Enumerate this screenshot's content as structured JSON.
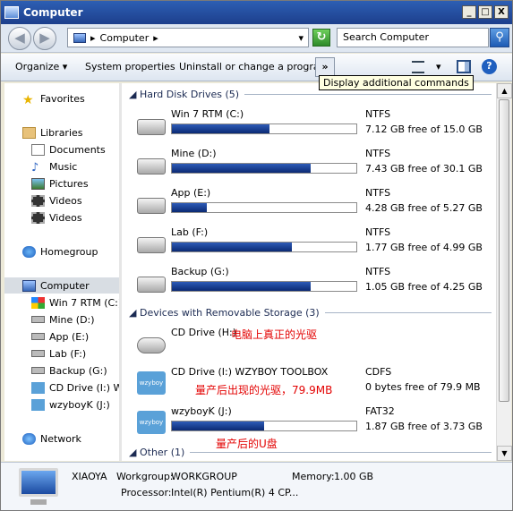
{
  "window": {
    "title": "Computer",
    "controls": [
      "_",
      "□",
      "X"
    ]
  },
  "address": {
    "back": "back",
    "forward": "forward",
    "path": "Computer",
    "search_placeholder": "Search Computer"
  },
  "toolbar": {
    "organize": "Organize",
    "system_properties": "System properties",
    "uninstall": "Uninstall or change a program",
    "more": "»",
    "tooltip": "Display additional commands"
  },
  "sidebar": {
    "favorites": "Favorites",
    "libraries": "Libraries",
    "lib_items": [
      "Documents",
      "Music",
      "Pictures",
      "Videos",
      "Videos"
    ],
    "homegroup": "Homegroup",
    "computer": "Computer",
    "computer_items": [
      "Win 7 RTM (C:)",
      "Mine (D:)",
      "App (E:)",
      "Lab (F:)",
      "Backup (G:)",
      "CD Drive (I:) WZ",
      "wzyboyK (J:)"
    ],
    "network": "Network"
  },
  "groups": {
    "hdd": "Hard Disk Drives (5)",
    "removable": "Devices with Removable Storage (3)",
    "other": "Other (1)"
  },
  "drives": [
    {
      "name": "Win 7 RTM (C:)",
      "fs": "NTFS",
      "free_text": "7.12 GB free of 15.0 GB",
      "used_fraction": 0.53
    },
    {
      "name": "Mine (D:)",
      "fs": "NTFS",
      "free_text": "7.43 GB free of 30.1 GB",
      "used_fraction": 0.75
    },
    {
      "name": "App (E:)",
      "fs": "NTFS",
      "free_text": "4.28 GB free of 5.27 GB",
      "used_fraction": 0.19
    },
    {
      "name": "Lab (F:)",
      "fs": "NTFS",
      "free_text": "1.77 GB free of 4.99 GB",
      "used_fraction": 0.65
    },
    {
      "name": "Backup (G:)",
      "fs": "NTFS",
      "free_text": "1.05 GB free of 4.25 GB",
      "used_fraction": 0.75
    }
  ],
  "removable": [
    {
      "name": "CD Drive (H:)",
      "annotation": "电脑上真正的光驱"
    },
    {
      "name": "CD Drive (I:) WZYBOY TOOLBOX",
      "fs": "CDFS",
      "free_text": "0 bytes free of 79.9 MB",
      "annotation": "量产后出现的光驱，79.9MB",
      "logo_text": "wzyboy"
    },
    {
      "name": "wzyboyK (J:)",
      "fs": "FAT32",
      "free_text": "1.87 GB free of 3.73 GB",
      "used_fraction": 0.5,
      "annotation": "量产后的U盘",
      "logo_text": "wzyboy"
    }
  ],
  "status": {
    "pc_name": "XIAOYA",
    "workgroup_label": "Workgroup:",
    "workgroup": "WORKGROUP",
    "memory_label": "Memory:",
    "memory": "1.00 GB",
    "processor_label": "Processor:",
    "processor": "Intel(R) Pentium(R) 4 CP..."
  },
  "colors": {
    "bar_fill": "#0b2a73",
    "annotation": "#e30000"
  }
}
